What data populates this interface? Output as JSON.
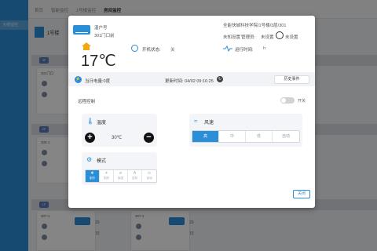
{
  "background": {
    "tabs": [
      "首页",
      "智能监控",
      "1号楼监控",
      "房间监控"
    ],
    "sidebar_label": "大楼监控",
    "building": "1号楼",
    "floors": [
      "3F",
      "2F",
      "1F"
    ],
    "rooms": {
      "r301": "301门口",
      "r305": "305-1",
      "r307_1": "307-1",
      "r307_2": "307-2"
    },
    "numbers": [
      "20",
      "15",
      "20",
      "15"
    ]
  },
  "modal": {
    "device_type": "温户号",
    "room_name": "301门口前",
    "current_temp": "17℃",
    "power_label": "开机状态:",
    "power_value": "关",
    "path": "全能快城科技学院/1号楼/3层/301",
    "unknown": "未知设置",
    "admin_label": "管理员:",
    "admin_value": "未设置",
    "phone_value": "未设置",
    "runtime_label": "运行时间:",
    "runtime_value": "h",
    "power_today": "当日电量:0度",
    "updated": "更新时间: 04/02 09:16:25",
    "history_button": "历史事件",
    "remote_title": "远程控制",
    "toggle_label": "开关",
    "temp_panel": {
      "title": "温度",
      "setpoint": "30℃",
      "minus_label": "−",
      "plus_label": "+"
    },
    "fan_panel": {
      "title": "风速",
      "options": [
        "高",
        "中",
        "低",
        "自动"
      ],
      "selected": "高"
    },
    "mode_panel": {
      "title": "模式",
      "options": [
        {
          "icon": "❄",
          "label": "制冷"
        },
        {
          "icon": "☀",
          "label": "制热"
        },
        {
          "icon": "≋",
          "label": "除湿"
        },
        {
          "icon": "A",
          "label": "送风"
        },
        {
          "icon": "⊙",
          "label": "自动"
        }
      ],
      "selected": "制冷"
    },
    "close_button": "关闭"
  }
}
